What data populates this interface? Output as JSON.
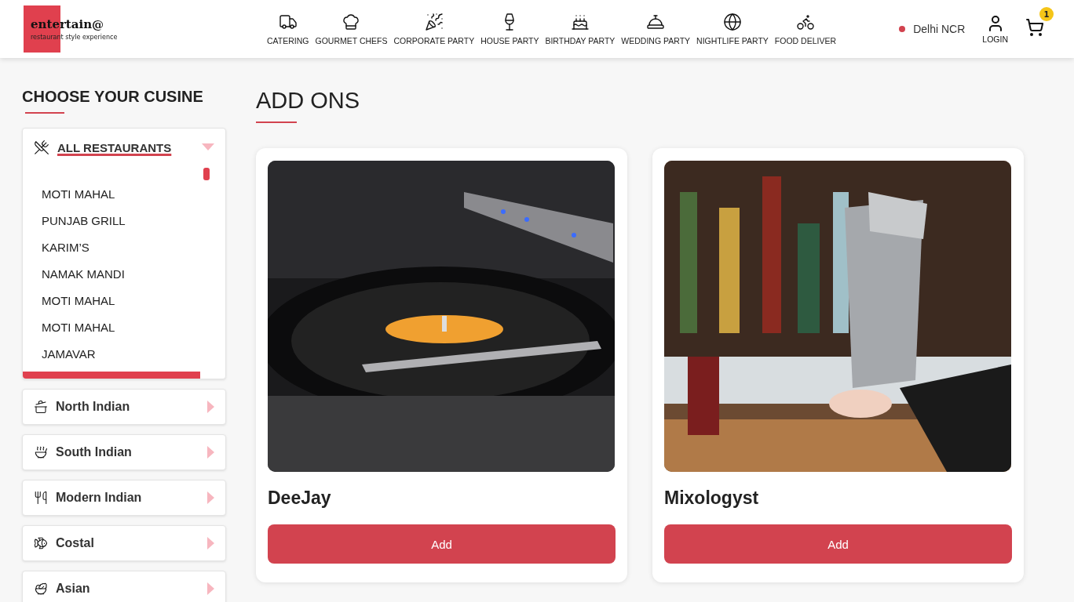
{
  "header": {
    "logo": {
      "name": "entertain@",
      "tagline": "restaurant style experience"
    },
    "nav": [
      {
        "label": "CATERING"
      },
      {
        "label": "GOURMET CHEFS"
      },
      {
        "label": "CORPORATE PARTY"
      },
      {
        "label": "HOUSE PARTY"
      },
      {
        "label": "BIRTHDAY PARTY"
      },
      {
        "label": "WEDDING PARTY"
      },
      {
        "label": "NIGHTLIFE PARTY"
      },
      {
        "label": "FOOD DELIVER"
      }
    ],
    "location": "Delhi NCR",
    "login": "LOGIN",
    "cart_count": "1"
  },
  "sidebar": {
    "title": "CHOOSE YOUR CUSINE",
    "categories": [
      {
        "label": "ALL RESTAURANTS",
        "expanded": true,
        "children": [
          {
            "label": "MOTI MAHAL"
          },
          {
            "label": "PUNJAB GRILL"
          },
          {
            "label": "KARIM’S"
          },
          {
            "label": "NAMAK MANDI"
          },
          {
            "label": "MOTI MAHAL"
          },
          {
            "label": "MOTI MAHAL"
          },
          {
            "label": "JAMAVAR"
          }
        ]
      },
      {
        "label": "North Indian",
        "expanded": false
      },
      {
        "label": "South Indian",
        "expanded": false
      },
      {
        "label": "Modern Indian",
        "expanded": false
      },
      {
        "label": "Costal",
        "expanded": false
      },
      {
        "label": "Asian",
        "expanded": false
      }
    ]
  },
  "main": {
    "title": "ADD ONS",
    "items": [
      {
        "name": "DeeJay",
        "button": "Add",
        "kind": "picture"
      },
      {
        "name": "Mixologyst",
        "button": "Add",
        "kind": "picture"
      }
    ]
  }
}
